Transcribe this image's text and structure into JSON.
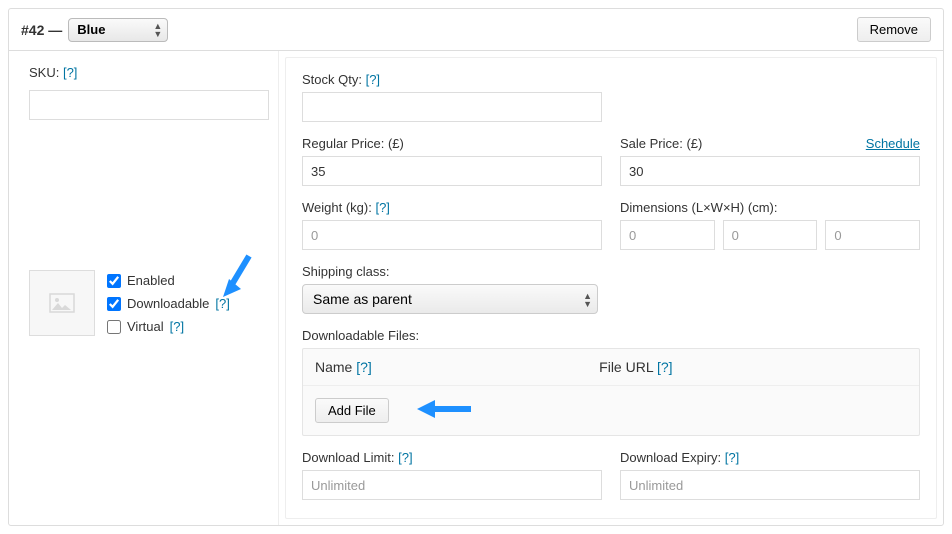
{
  "header": {
    "var_id": "#42 —",
    "attr_selected": "Blue",
    "remove_label": "Remove"
  },
  "sku": {
    "label": "SKU:",
    "help": "[?]"
  },
  "thumb": {
    "icon": "image-placeholder"
  },
  "checks": {
    "enabled": {
      "label": "Enabled",
      "checked": true
    },
    "downloadable": {
      "label": "Downloadable",
      "checked": true,
      "help": "[?]"
    },
    "virtual": {
      "label": "Virtual",
      "checked": false,
      "help": "[?]"
    }
  },
  "stock": {
    "label": "Stock Qty:",
    "help": "[?]",
    "value": ""
  },
  "regular_price": {
    "label": "Regular Price: (£)",
    "value": "35"
  },
  "sale_price": {
    "label": "Sale Price: (£)",
    "value": "30",
    "schedule": "Schedule"
  },
  "weight": {
    "label": "Weight (kg):",
    "help": "[?]",
    "placeholder": "0"
  },
  "dimensions": {
    "label": "Dimensions (L×W×H) (cm):",
    "l_ph": "0",
    "w_ph": "0",
    "h_ph": "0"
  },
  "shipping_class": {
    "label": "Shipping class:",
    "selected": "Same as parent"
  },
  "dl_files": {
    "label": "Downloadable Files:",
    "col_name": "Name",
    "col_url": "File URL",
    "help": "[?]",
    "add_file": "Add File"
  },
  "dl_limit": {
    "label": "Download Limit:",
    "help": "[?]",
    "placeholder": "Unlimited"
  },
  "dl_expiry": {
    "label": "Download Expiry:",
    "help": "[?]",
    "placeholder": "Unlimited"
  }
}
